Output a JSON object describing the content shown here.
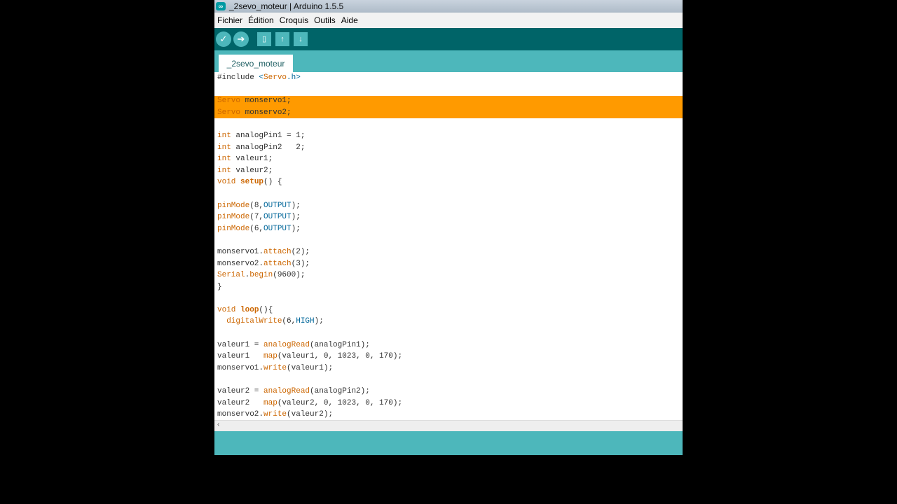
{
  "window": {
    "title": "_2sevo_moteur | Arduino 1.5.5",
    "app_icon": "∞"
  },
  "menu": {
    "items": [
      "Fichier",
      "Édition",
      "Croquis",
      "Outils",
      "Aide"
    ]
  },
  "toolbar": {
    "verify_icon": "✓",
    "upload_icon": "➔",
    "new_icon": "▯",
    "open_icon": "↑",
    "save_icon": "↓"
  },
  "tabs": {
    "active": "_2sevo_moteur"
  },
  "editor": {
    "lines": [
      "#include <Servo.h>",
      "",
      "Servo monservo1;",
      "Servo monservo2;",
      "",
      "int analogPin1 = 1;",
      "int analogPin2   2;",
      "int valeur1;",
      "int valeur2;",
      "void setup() {",
      "",
      "pinMode(8,OUTPUT);",
      "pinMode(7,OUTPUT);",
      "pinMode(6,OUTPUT);",
      "",
      "monservo1.attach(2);",
      "monservo2.attach(3);",
      "Serial.begin(9600);",
      "}",
      "",
      "void loop(){",
      "  digitalWrite(6,HIGH);",
      "",
      "valeur1 = analogRead(analogPin1);",
      "valeur1   map(valeur1, 0, 1023, 0, 170);",
      "monservo1.write(valeur1);",
      "",
      "valeur2 = analogRead(analogPin2);",
      "valeur2   map(valeur2, 0, 1023, 0, 170);",
      "monservo2.write(valeur2);"
    ],
    "highlighted_lines": [
      2,
      3
    ],
    "highlight_color": "#ff9a00"
  },
  "scrollbar": {
    "left_arrow": "‹"
  },
  "colors": {
    "toolbar": "#006468",
    "tabbar": "#4db7bb",
    "button": "#4db7bb",
    "keyword": "#cc6600",
    "constant": "#006699"
  }
}
